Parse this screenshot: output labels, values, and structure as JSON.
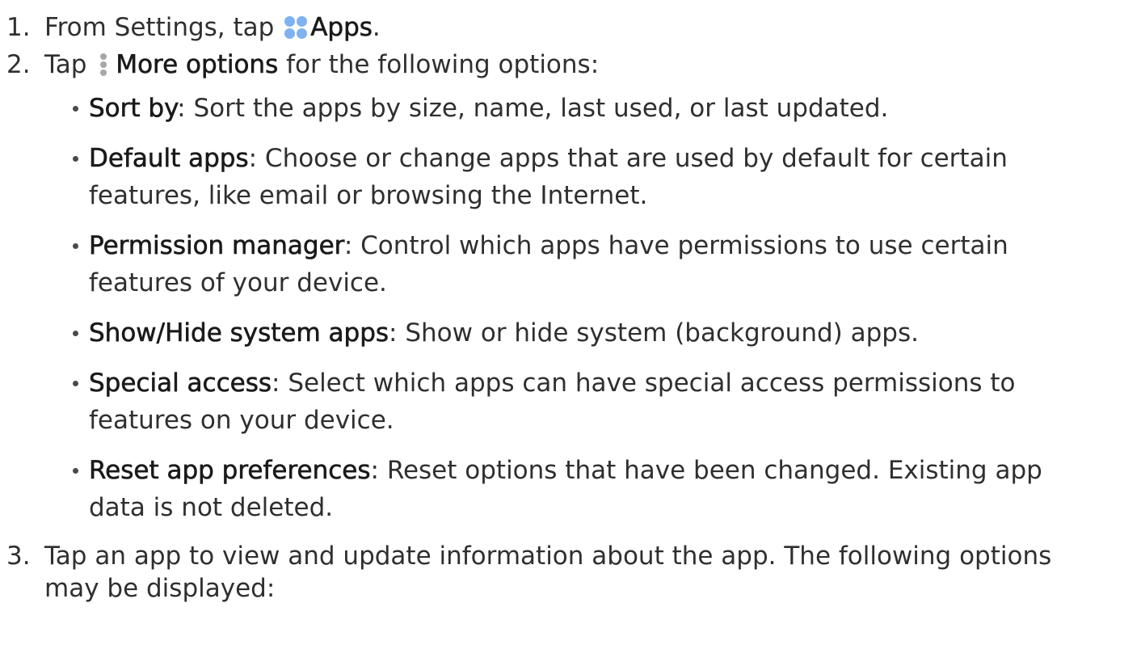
{
  "steps": [
    {
      "number": "1.",
      "before": "From Settings, tap",
      "icon": "apps-icon",
      "strong": "Apps",
      "after": "."
    },
    {
      "number": "2.",
      "before": "Tap",
      "icon": "more-options-icon",
      "strong": "More options",
      "after": "for the following options:"
    },
    {
      "number": "3.",
      "line1": "Tap an app to view and update information about the app. The following options",
      "line2": "may be displayed:"
    }
  ],
  "options": [
    {
      "term": "Sort by",
      "line1": ": Sort the apps by size, name, last used, or last updated.",
      "line2": ""
    },
    {
      "term": "Default apps",
      "line1": ": Choose or change apps that are used by default for certain",
      "line2": "features, like email or browsing the Internet."
    },
    {
      "term": "Permission manager",
      "line1": ": Control which apps have permissions to use certain",
      "line2": "features of your device."
    },
    {
      "term": "Show/Hide system apps",
      "line1": ": Show or hide system (background) apps.",
      "line2": ""
    },
    {
      "term": "Special access",
      "line1": ": Select which apps can have special access permissions to",
      "line2": "features on your device."
    },
    {
      "term": "Reset app preferences",
      "line1": ": Reset options that have been changed. Existing app",
      "line2": "data is not deleted."
    }
  ],
  "colors": {
    "text": "#2f2f2f",
    "apps_icon": "#7fb2f0",
    "more_icon": "#a7a7a7"
  }
}
